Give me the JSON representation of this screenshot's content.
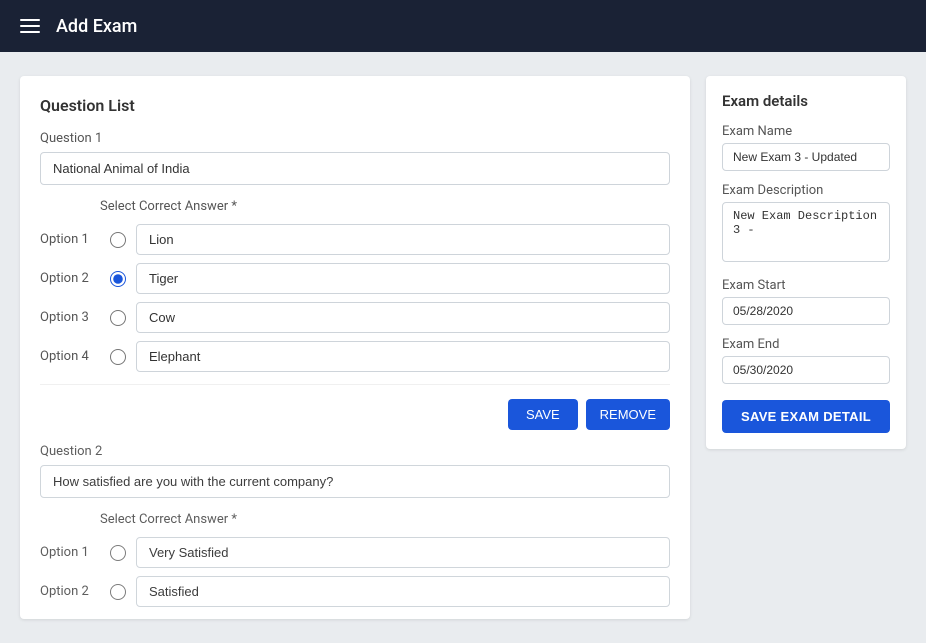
{
  "topbar": {
    "title": "Add Exam",
    "menu_icon": "menu-icon"
  },
  "left_panel": {
    "title": "Question List",
    "question1": {
      "label": "Question 1",
      "value": "National Animal of India",
      "select_correct_label": "Select Correct Answer *",
      "options": [
        {
          "label": "Option 1",
          "value": "Lion",
          "selected": false
        },
        {
          "label": "Option 2",
          "value": "Tiger",
          "selected": true
        },
        {
          "label": "Option 3",
          "value": "Cow",
          "selected": false
        },
        {
          "label": "Option 4",
          "value": "Elephant",
          "selected": false
        }
      ],
      "save_button": "SAVE",
      "remove_button": "REMOVE"
    },
    "question2": {
      "label": "Question 2",
      "value": "How satisfied are you with the current company?",
      "select_correct_label": "Select Correct Answer *",
      "options": [
        {
          "label": "Option 1",
          "value": "Very Satisfied",
          "selected": false
        },
        {
          "label": "Option 2",
          "value": "Satisfied",
          "selected": false
        }
      ]
    }
  },
  "right_panel": {
    "title": "Exam details",
    "exam_name_label": "Exam Name",
    "exam_name_value": "New Exam 3 - Updated",
    "exam_name_placeholder": "New Exam 3 - Updated",
    "exam_description_label": "Exam Description",
    "exam_description_value": "New Exam Description 3 -",
    "exam_start_label": "Exam Start",
    "exam_start_value": "05/28/2020",
    "exam_end_label": "Exam End",
    "exam_end_value": "05/30/2020",
    "save_button": "SAVE EXAM DETAIL"
  }
}
